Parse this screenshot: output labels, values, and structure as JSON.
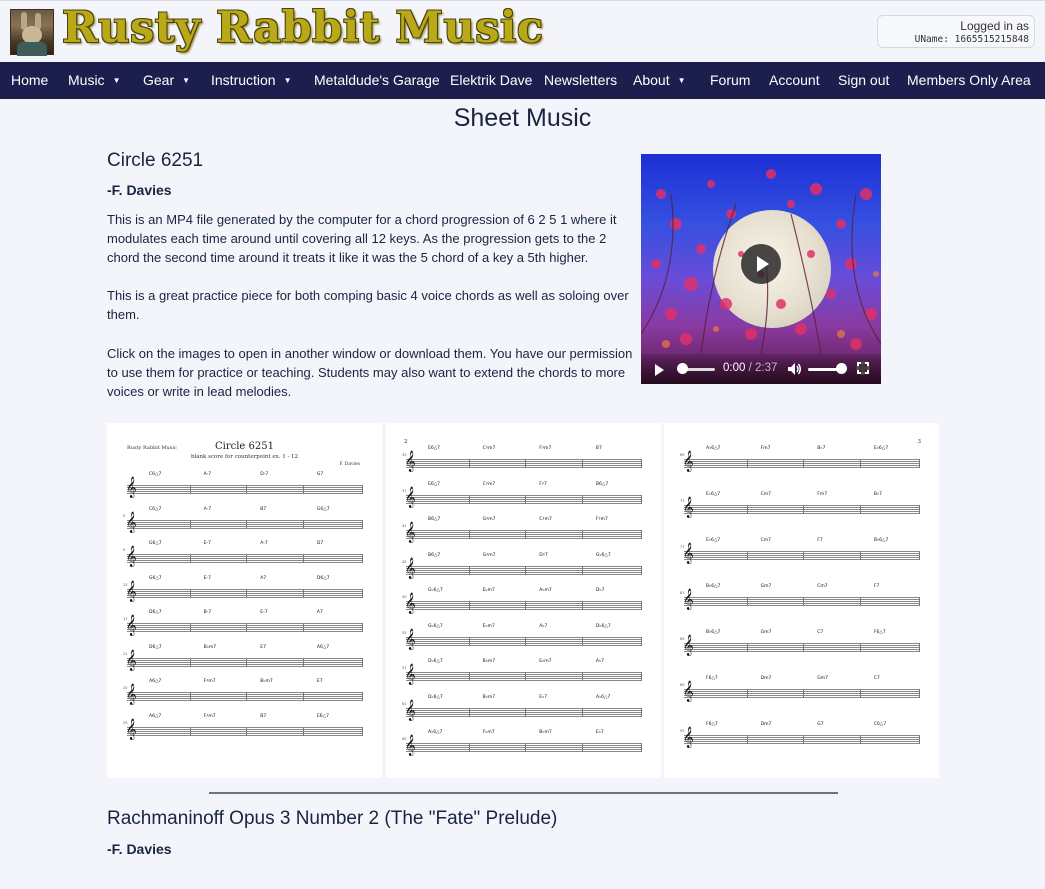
{
  "header": {
    "site_title": "Rusty Rabbit Music",
    "login_line1": "Logged in as",
    "login_line2": "UName: 1665515215848"
  },
  "nav": {
    "items": [
      {
        "label": "Home",
        "dropdown": false
      },
      {
        "label": "Music",
        "dropdown": true
      },
      {
        "label": "Gear",
        "dropdown": true
      },
      {
        "label": "Instruction",
        "dropdown": true
      },
      {
        "label": "Metaldude's Garage",
        "dropdown": false
      },
      {
        "label": "Elektrik Dave",
        "dropdown": false
      },
      {
        "label": "Newsletters",
        "dropdown": false
      },
      {
        "label": "About",
        "dropdown": true
      },
      {
        "label": "Forum",
        "dropdown": false
      },
      {
        "label": "Account",
        "dropdown": false
      },
      {
        "label": "Sign out",
        "dropdown": false
      },
      {
        "label": "Members Only Area",
        "dropdown": false
      }
    ],
    "caret_glyph": "▼"
  },
  "page": {
    "title": "Sheet Music"
  },
  "section1": {
    "title": "Circle 6251",
    "author": "-F. Davies",
    "paragraphs": [
      "This is an MP4 file generated by the computer for a chord progression of 6 2 5 1 where it modulates each time around until covering all 12 keys. As the progression gets to the 2 chord the second time around it treats it like it was the 5 chord of a key a 5th higher.",
      "This is a great practice piece for both comping basic 4 voice chords as well as soloing over them.",
      "Click on the images to open in another window or download them. You have our permission to use them for practice or teaching. Students may also want to extend the chords to more voices or write in lead melodies."
    ],
    "video": {
      "current_time": "0:00",
      "separator": " / ",
      "duration": "2:37",
      "progress": 0,
      "volume": 0.85,
      "icons": [
        "play-icon",
        "volume-icon",
        "fullscreen-icon"
      ]
    },
    "sheets": [
      {
        "page_label": "",
        "header_left": "Rusty Rabbit Music",
        "header_title": "Circle 6251",
        "header_subtitle": "blank score for counterpoint ex. 1 - 12",
        "header_right": "F. Davies",
        "systems": [
          {
            "num": "",
            "chords": [
              "C6△7",
              "A-7",
              "D-7",
              "G7"
            ]
          },
          {
            "num": "5",
            "chords": [
              "C6△7",
              "A-7",
              "B7",
              "G6△7"
            ]
          },
          {
            "num": "9",
            "chords": [
              "G6△7",
              "E-7",
              "A-7",
              "D7"
            ]
          },
          {
            "num": "13",
            "chords": [
              "G6△7",
              "E-7",
              "A7",
              "D6△7"
            ]
          },
          {
            "num": "17",
            "chords": [
              "D6△7",
              "B-7",
              "E-7",
              "A7"
            ]
          },
          {
            "num": "21",
            "chords": [
              "D6△7",
              "B♭m7",
              "E7",
              "A6△7"
            ]
          },
          {
            "num": "25",
            "chords": [
              "A6△7",
              "F♯m7",
              "B♭m7",
              "E7"
            ]
          },
          {
            "num": "29",
            "chords": [
              "A6△7",
              "F♯m7",
              "B7",
              "E6△7"
            ]
          }
        ]
      },
      {
        "page_label": "2",
        "systems": [
          {
            "num": "33",
            "chords": [
              "E6△7",
              "C♯m7",
              "F♯m7",
              "B7"
            ]
          },
          {
            "num": "37",
            "chords": [
              "E6△7",
              "C♯m7",
              "F♯7",
              "B6△7"
            ]
          },
          {
            "num": "41",
            "chords": [
              "B6△7",
              "G♯m7",
              "C♯m7",
              "F♯m7"
            ]
          },
          {
            "num": "45",
            "chords": [
              "B6△7",
              "G♯m7",
              "D♯7",
              "G♭6△7"
            ]
          },
          {
            "num": "49",
            "chords": [
              "G♭6△7",
              "E♭m7",
              "A♭m7",
              "D♭7"
            ]
          },
          {
            "num": "53",
            "chords": [
              "G♭6△7",
              "E♭m7",
              "A♭7",
              "D♭6△7"
            ]
          },
          {
            "num": "57",
            "chords": [
              "D♭6△7",
              "B♭m7",
              "E♭m7",
              "A♭7"
            ]
          },
          {
            "num": "61",
            "chords": [
              "D♭6△7",
              "B♭m7",
              "E♭7",
              "A♭6△7"
            ]
          },
          {
            "num": "65",
            "chords": [
              "A♭6△7",
              "F♭m7",
              "B♭m7",
              "E♭7"
            ]
          }
        ]
      },
      {
        "page_label": "3",
        "systems": [
          {
            "num": "69",
            "chords": [
              "A♭6△7",
              "Fm7",
              "B♭7",
              "E♭6△7"
            ]
          },
          {
            "num": "73",
            "chords": [
              "E♭6△7",
              "Cm7",
              "Fm7",
              "B♭7"
            ]
          },
          {
            "num": "77",
            "chords": [
              "E♭6△7",
              "Cm7",
              "F7",
              "B♭6△7"
            ]
          },
          {
            "num": "81",
            "chords": [
              "B♭6△7",
              "Gm7",
              "Cm7",
              "F7"
            ]
          },
          {
            "num": "85",
            "chords": [
              "B♭6△7",
              "Gm7",
              "C7",
              "F6△7"
            ]
          },
          {
            "num": "89",
            "chords": [
              "F6△7",
              "Dm7",
              "Gm7",
              "C7"
            ]
          },
          {
            "num": "93",
            "chords": [
              "F6△7",
              "Dm7",
              "G7",
              "C6△7"
            ]
          }
        ]
      }
    ]
  },
  "section2": {
    "title": "Rachmaninoff Opus 3 Number 2 (The \"Fate\" Prelude)",
    "author": "-F. Davies"
  },
  "colors": {
    "nav_bg": "#1c1f4e",
    "page_bg": "#f4f5fb",
    "heading": "#1a2440",
    "logo_gold": "#b9a817"
  }
}
